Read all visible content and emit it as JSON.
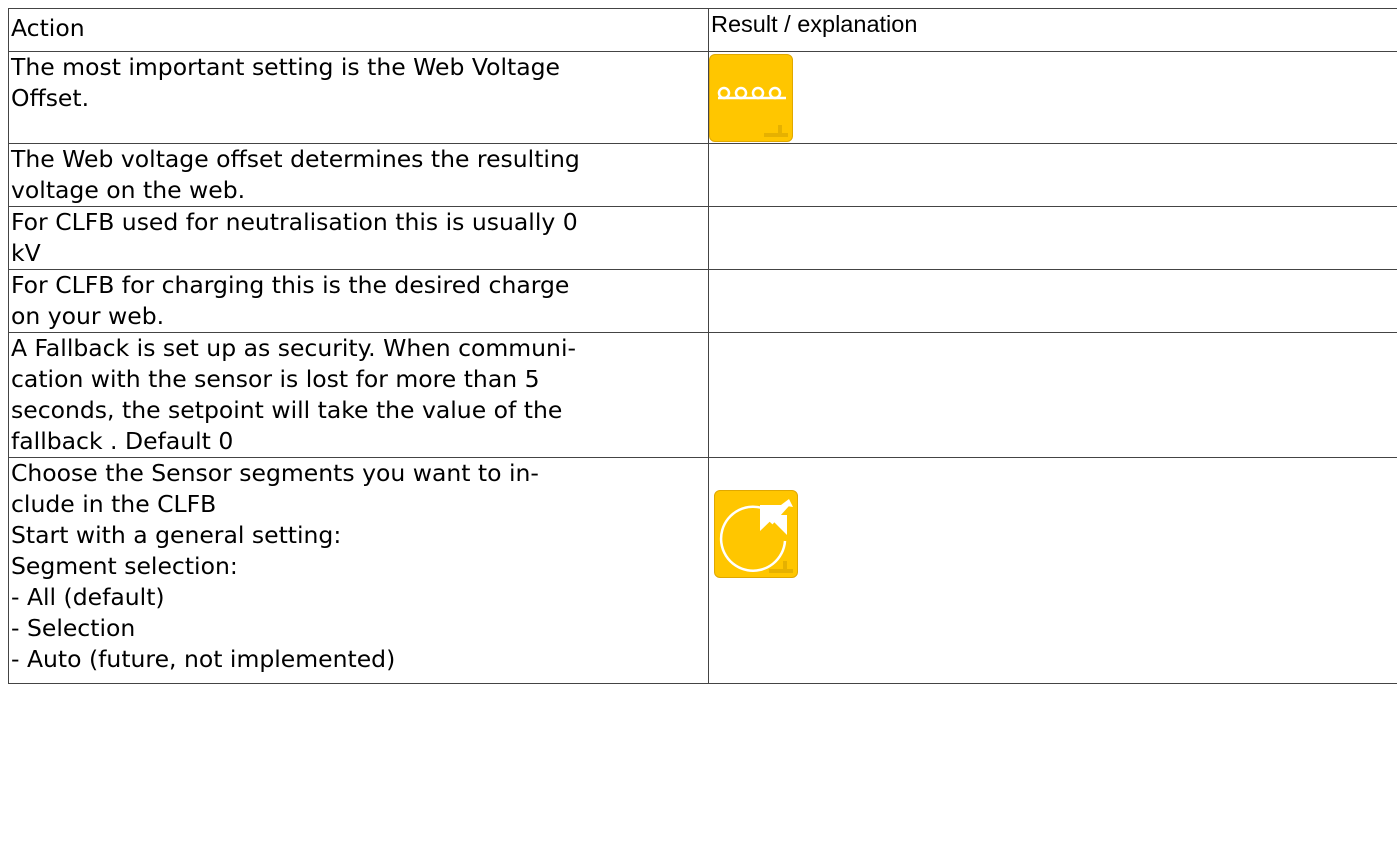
{
  "table": {
    "header": {
      "action": "Action",
      "result": "Result / explanation"
    },
    "rows": [
      {
        "action_lines": [
          "The most important setting is the Web Voltage",
          "Offset."
        ],
        "icon": "web-voltage-offset-icon"
      },
      {
        "action_lines": [
          "The Web voltage offset determines the resulting",
          "voltage on the web."
        ]
      },
      {
        "action_lines": [
          "For CLFB used for neutralisation this is usually 0",
          "kV"
        ]
      },
      {
        "action_lines": [
          "For CLFB for charging this is the desired charge",
          "on your web."
        ]
      },
      {
        "action_lines": [
          "A Fallback is set up as security. When communi-",
          "cation with the sensor is lost for more than 5",
          "seconds, the setpoint will take the value of the",
          "fallback . Default 0"
        ]
      },
      {
        "action_lines": [
          "Choose the Sensor segments you want to in-",
          "clude in the CLFB",
          "Start with a general setting:",
          "Segment selection:",
          "- All (default)",
          "- Selection",
          "- Auto (future, not implemented)"
        ],
        "icon": "segment-selection-icon"
      }
    ]
  },
  "colors": {
    "icon_yellow": "#ffc600",
    "border": "#444444"
  }
}
